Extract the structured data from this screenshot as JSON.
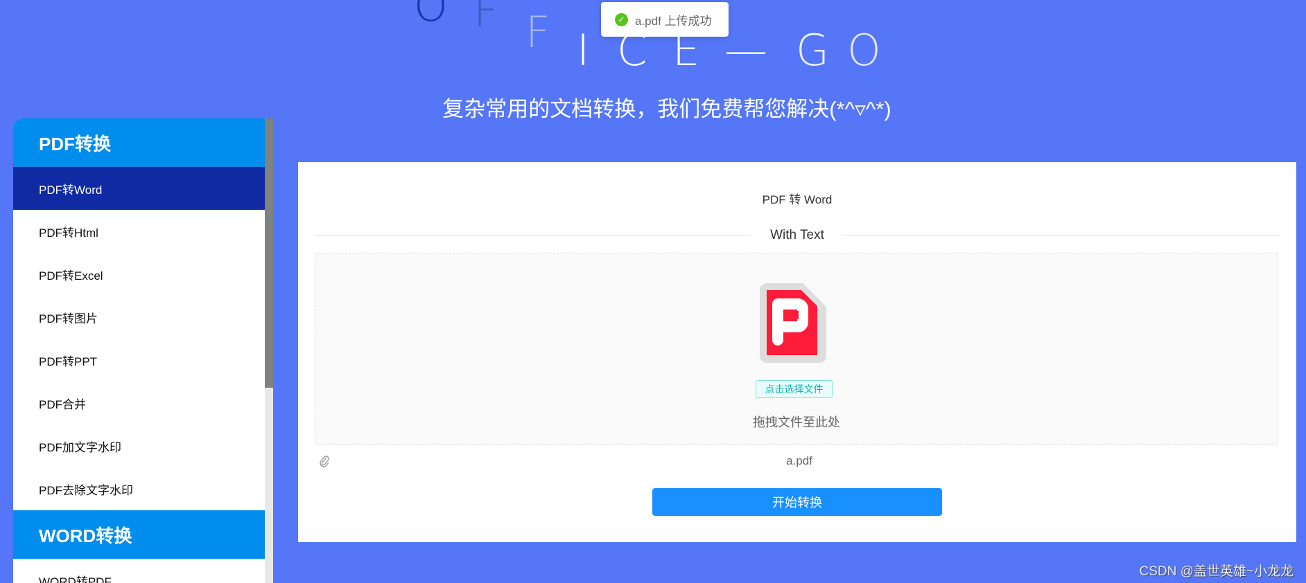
{
  "logo": {
    "letters": [
      "O",
      "F",
      "F",
      "I",
      "C",
      "E",
      "—",
      "G",
      "O"
    ]
  },
  "subtitle": "复杂常用的文档转换，我们免费帮您解决(*^▿^*)",
  "toast": {
    "icon": "check-circle-icon",
    "message": "a.pdf 上传成功"
  },
  "sidebar": {
    "groups": [
      {
        "title": "PDF转换",
        "items": [
          "PDF转Word",
          "PDF转Html",
          "PDF转Excel",
          "PDF转图片",
          "PDF转PPT",
          "PDF合并",
          "PDF加文字水印",
          "PDF去除文字水印"
        ]
      },
      {
        "title": "WORD转换",
        "items": [
          "WORD转PDF"
        ]
      }
    ],
    "active": "PDF转Word"
  },
  "main": {
    "title": "PDF 转 Word",
    "divider": "With Text",
    "choose_button": "点击选择文件",
    "drag_hint": "拖拽文件至此处",
    "file_name": "a.pdf",
    "convert_button": "开始转换"
  },
  "watermark": "CSDN @盖世英雄~小龙龙",
  "colors": {
    "background": "#5476f7",
    "group": "#008ded",
    "active": "#0f2aa2",
    "button": "#1890ff",
    "pdf_red": "#ff1b3a"
  }
}
